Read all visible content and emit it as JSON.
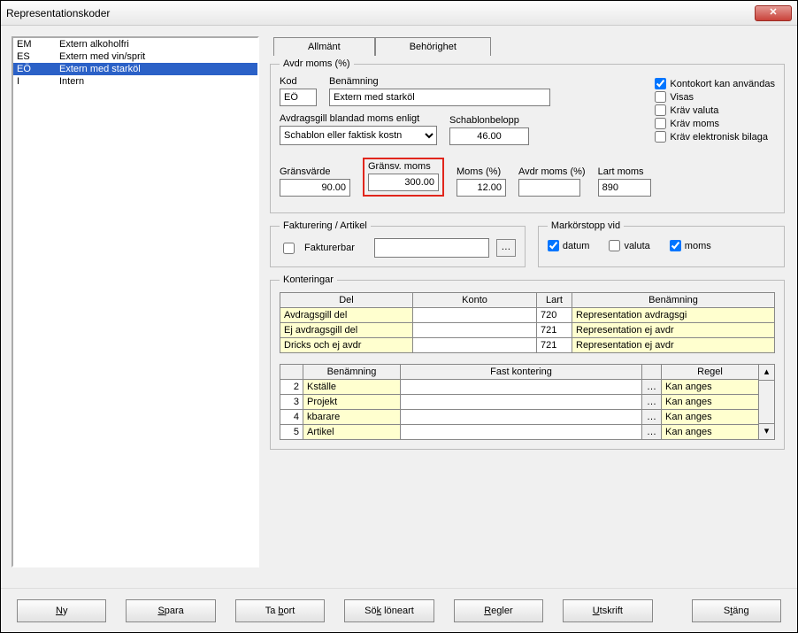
{
  "window": {
    "title": "Representationskoder"
  },
  "list": {
    "items": [
      {
        "code": "EM",
        "name": "Extern alkoholfri",
        "selected": false
      },
      {
        "code": "ES",
        "name": "Extern med vin/sprit",
        "selected": false
      },
      {
        "code": "EÖ",
        "name": "Extern med starköl",
        "selected": true
      },
      {
        "code": "I",
        "name": "Intern",
        "selected": false
      }
    ]
  },
  "tabs": {
    "general": "Allmänt",
    "permissions": "Behörighet"
  },
  "avdr": {
    "legend": "Avdr moms (%)",
    "kod_label": "Kod",
    "kod": "EÖ",
    "ben_label": "Benämning",
    "ben": "Extern med starköl",
    "mix_label": "Avdragsgill blandad moms enligt",
    "mix_value": "Schablon eller faktisk kostn",
    "schablon_label": "Schablonbelopp",
    "schablon": "46.00",
    "gransvarde_label": "Gränsvärde",
    "gransvarde": "90.00",
    "gransmoms_label": "Gränsv. moms",
    "gransmoms": "300.00",
    "momspct_label": "Moms (%)",
    "momspct": "12.00",
    "avdrmomspct_label": "Avdr moms (%)",
    "avdrmomspct": "",
    "lartmoms_label": "Lart moms",
    "lartmoms": "890",
    "chk": {
      "kontokort": "Kontokort kan användas",
      "visas": "Visas",
      "krav_valuta": "Kräv valuta",
      "krav_moms": "Kräv moms",
      "krav_ebilaga": "Kräv elektronisk bilaga"
    }
  },
  "fakt": {
    "legend": "Fakturering / Artikel",
    "fakturerbar": "Fakturerbar"
  },
  "markor": {
    "legend": "Markörstopp vid",
    "datum": "datum",
    "valuta": "valuta",
    "moms": "moms"
  },
  "kont": {
    "legend": "Konteringar",
    "headers": {
      "del": "Del",
      "konto": "Konto",
      "lart": "Lart",
      "ben": "Benämning"
    },
    "rows": [
      {
        "del": "Avdragsgill del",
        "konto": "",
        "lart": "720",
        "ben": "Representation avdragsgi"
      },
      {
        "del": "Ej avdragsgill del",
        "konto": "",
        "lart": "721",
        "ben": "Representation ej avdr"
      },
      {
        "del": "Dricks och ej avdr",
        "konto": "",
        "lart": "721",
        "ben": "Representation ej avdr"
      }
    ],
    "headers2": {
      "ben": "Benämning",
      "fast": "Fast kontering",
      "regel": "Regel"
    },
    "rows2": [
      {
        "n": "2",
        "ben": "Kställe",
        "fast": "",
        "regel": "Kan anges"
      },
      {
        "n": "3",
        "ben": "Projekt",
        "fast": "",
        "regel": "Kan anges"
      },
      {
        "n": "4",
        "ben": "kbarare",
        "fast": "",
        "regel": "Kan anges"
      },
      {
        "n": "5",
        "ben": "Artikel",
        "fast": "",
        "regel": "Kan anges"
      }
    ]
  },
  "buttons": {
    "ny": "Ny",
    "spara": "Spara",
    "tabort": "Ta bort",
    "sok": "Sök löneart",
    "regler": "Regler",
    "utskrift": "Utskrift",
    "stang": "Stäng"
  }
}
